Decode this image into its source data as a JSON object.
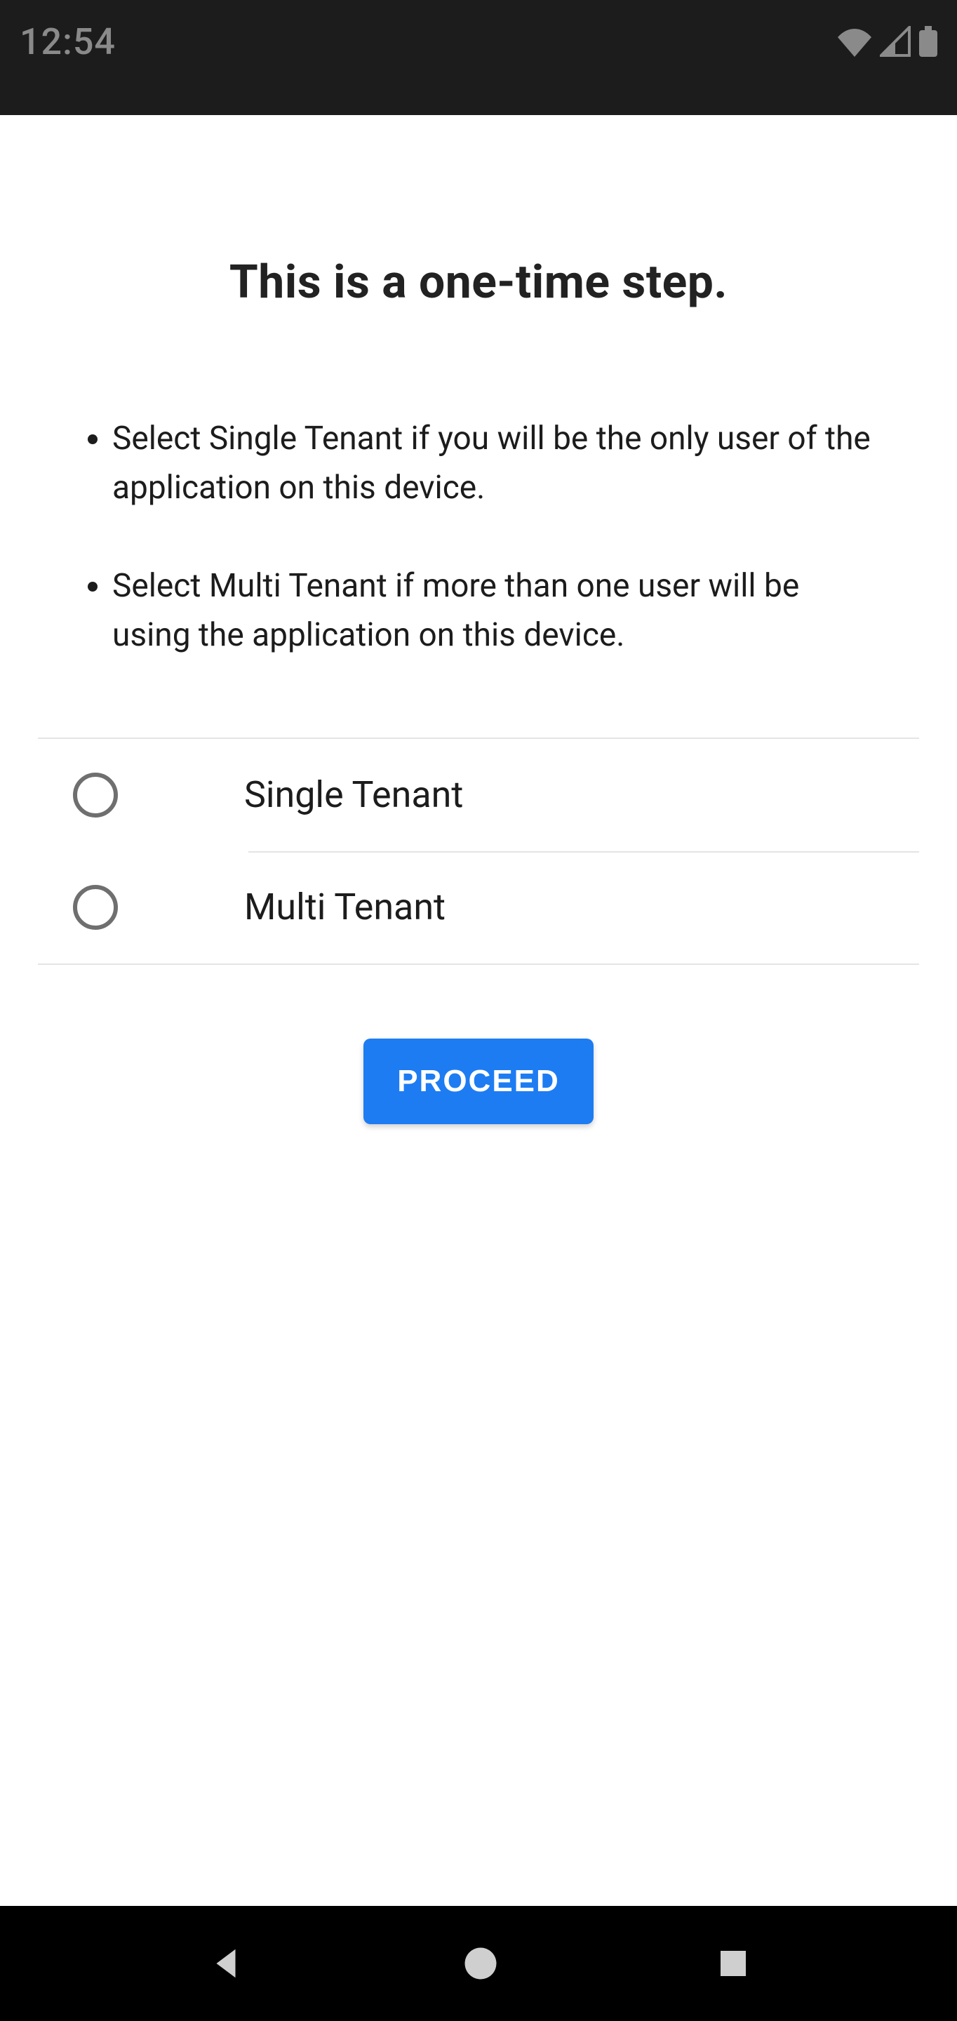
{
  "statusbar": {
    "time": "12:54"
  },
  "page": {
    "title": "This is a one-time step.",
    "instructions": [
      "Select Single Tenant if you will be the only user of the application on this device.",
      "Select Multi Tenant if more than one user will be using the application on this device."
    ],
    "options": [
      {
        "label": "Single Tenant",
        "selected": false
      },
      {
        "label": "Multi Tenant",
        "selected": false
      }
    ],
    "proceed_label": "PROCEED"
  }
}
